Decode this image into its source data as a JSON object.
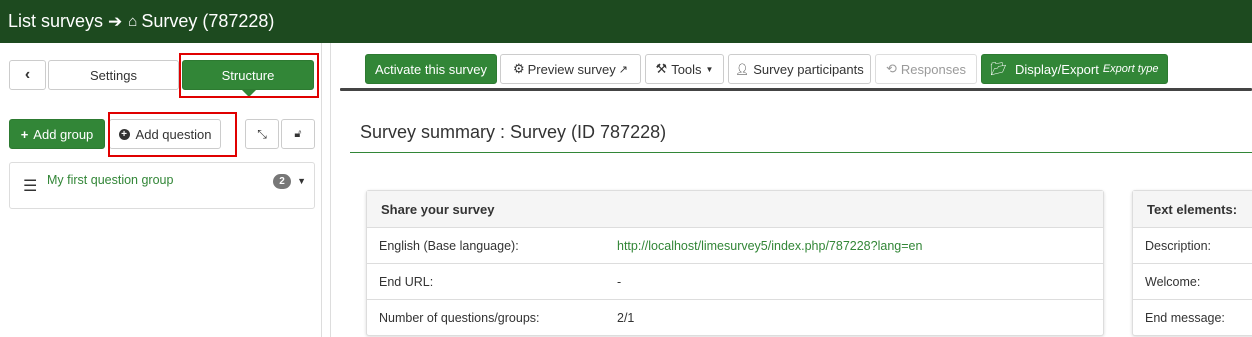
{
  "breadcrumb": {
    "list_surveys": "List surveys",
    "survey": "Survey (787228)"
  },
  "sidebar": {
    "tabs": {
      "settings": "Settings",
      "structure": "Structure"
    },
    "add_group": "Add group",
    "add_question": "Add question",
    "question_group": {
      "name": "My first question group",
      "count": "2"
    }
  },
  "toolbar": {
    "activate": "Activate this survey",
    "preview": "Preview survey",
    "tools": "Tools",
    "participants": "Survey participants",
    "responses": "Responses",
    "display_export": "Display/Export",
    "export_type": "Export type"
  },
  "main": {
    "title": "Survey summary : Survey (ID 787228)",
    "share_panel": {
      "heading": "Share your survey",
      "rows": [
        {
          "label": "English (Base language):",
          "value": "http://localhost/limesurvey5/index.php/787228?lang=en"
        },
        {
          "label": "End URL:",
          "value": "-"
        },
        {
          "label": "Number of questions/groups:",
          "value": "2/1"
        }
      ]
    },
    "text_panel": {
      "heading": "Text elements:",
      "rows": [
        {
          "label": "Description:"
        },
        {
          "label": "Welcome:"
        },
        {
          "label": "End message:"
        }
      ]
    }
  },
  "colors": {
    "topbar": "#1d4a1f",
    "accent_green": "#328637",
    "highlight_red": "#e00000"
  }
}
